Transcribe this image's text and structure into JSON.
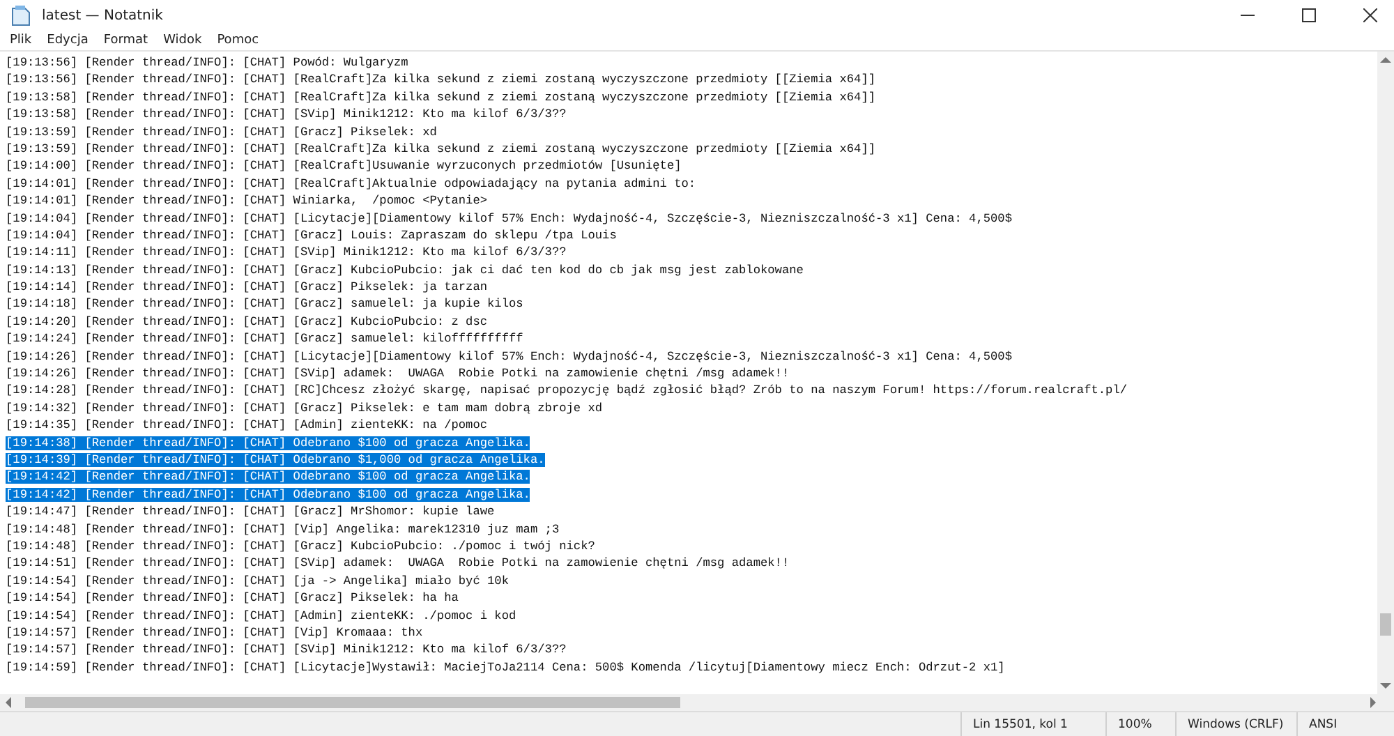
{
  "window": {
    "title": "latest — Notatnik"
  },
  "menu": [
    "Plik",
    "Edycja",
    "Format",
    "Widok",
    "Pomoc"
  ],
  "lines": [
    {
      "text": "[19:13:56] [Render thread/INFO]: [CHAT] Powód: Wulgaryzm",
      "selected": false
    },
    {
      "text": "[19:13:56] [Render thread/INFO]: [CHAT] [RealCraft]Za kilka sekund z ziemi zostaną wyczyszczone przedmioty [[Ziemia x64]]",
      "selected": false
    },
    {
      "text": "[19:13:58] [Render thread/INFO]: [CHAT] [RealCraft]Za kilka sekund z ziemi zostaną wyczyszczone przedmioty [[Ziemia x64]]",
      "selected": false
    },
    {
      "text": "[19:13:58] [Render thread/INFO]: [CHAT] [SVip] Minik1212: Kto ma kilof 6/3/3??",
      "selected": false
    },
    {
      "text": "[19:13:59] [Render thread/INFO]: [CHAT] [Gracz] Pikselek: xd",
      "selected": false
    },
    {
      "text": "[19:13:59] [Render thread/INFO]: [CHAT] [RealCraft]Za kilka sekund z ziemi zostaną wyczyszczone przedmioty [[Ziemia x64]]",
      "selected": false
    },
    {
      "text": "[19:14:00] [Render thread/INFO]: [CHAT] [RealCraft]Usuwanie wyrzuconych przedmiotów [Usunięte]",
      "selected": false
    },
    {
      "text": "[19:14:01] [Render thread/INFO]: [CHAT] [RealCraft]Aktualnie odpowiadający na pytania admini to:",
      "selected": false
    },
    {
      "text": "[19:14:01] [Render thread/INFO]: [CHAT] Winiarka,  /pomoc <Pytanie>",
      "selected": false
    },
    {
      "text": "[19:14:04] [Render thread/INFO]: [CHAT] [Licytacje][Diamentowy kilof 57% Ench: Wydajność-4, Szczęście-3, Niezniszczalność-3 x1] Cena: 4,500$",
      "selected": false
    },
    {
      "text": "[19:14:04] [Render thread/INFO]: [CHAT] [Gracz] Louis: Zapraszam do sklepu /tpa Louis",
      "selected": false
    },
    {
      "text": "[19:14:11] [Render thread/INFO]: [CHAT] [SVip] Minik1212: Kto ma kilof 6/3/3??",
      "selected": false
    },
    {
      "text": "[19:14:13] [Render thread/INFO]: [CHAT] [Gracz] KubcioPubcio: jak ci dać ten kod do cb jak msg jest zablokowane",
      "selected": false
    },
    {
      "text": "[19:14:14] [Render thread/INFO]: [CHAT] [Gracz] Pikselek: ja tarzan",
      "selected": false
    },
    {
      "text": "[19:14:18] [Render thread/INFO]: [CHAT] [Gracz] samuelel: ja kupie kilos",
      "selected": false
    },
    {
      "text": "[19:14:20] [Render thread/INFO]: [CHAT] [Gracz] KubcioPubcio: z dsc",
      "selected": false
    },
    {
      "text": "[19:14:24] [Render thread/INFO]: [CHAT] [Gracz] samuelel: kiloffffffffff",
      "selected": false
    },
    {
      "text": "[19:14:26] [Render thread/INFO]: [CHAT] [Licytacje][Diamentowy kilof 57% Ench: Wydajność-4, Szczęście-3, Niezniszczalność-3 x1] Cena: 4,500$",
      "selected": false
    },
    {
      "text": "[19:14:26] [Render thread/INFO]: [CHAT] [SVip] adamek:  UWAGA  Robie Potki na zamowienie chętni /msg adamek!!",
      "selected": false
    },
    {
      "text": "[19:14:28] [Render thread/INFO]: [CHAT] [RC]Chcesz złożyć skargę, napisać propozycję bądź zgłosić błąd? Zrób to na naszym Forum! https://forum.realcraft.pl/",
      "selected": false
    },
    {
      "text": "[19:14:32] [Render thread/INFO]: [CHAT] [Gracz] Pikselek: e tam mam dobrą zbroje xd",
      "selected": false
    },
    {
      "text": "[19:14:35] [Render thread/INFO]: [CHAT] [Admin] zienteKK: na /pomoc",
      "selected": false
    },
    {
      "text": "[19:14:38] [Render thread/INFO]: [CHAT] Odebrano $100 od gracza Angelika.",
      "selected": true
    },
    {
      "text": "[19:14:39] [Render thread/INFO]: [CHAT] Odebrano $1,000 od gracza Angelika.",
      "selected": true
    },
    {
      "text": "[19:14:42] [Render thread/INFO]: [CHAT] Odebrano $100 od gracza Angelika.",
      "selected": true
    },
    {
      "text": "[19:14:42] [Render thread/INFO]: [CHAT] Odebrano $100 od gracza Angelika.",
      "selected": true
    },
    {
      "text": "[19:14:47] [Render thread/INFO]: [CHAT] [Gracz] MrShomor: kupie lawe",
      "selected": false
    },
    {
      "text": "[19:14:48] [Render thread/INFO]: [CHAT] [Vip] Angelika: marek12310 juz mam ;3",
      "selected": false
    },
    {
      "text": "[19:14:48] [Render thread/INFO]: [CHAT] [Gracz] KubcioPubcio: ./pomoc i twój nick?",
      "selected": false
    },
    {
      "text": "[19:14:51] [Render thread/INFO]: [CHAT] [SVip] adamek:  UWAGA  Robie Potki na zamowienie chętni /msg adamek!!",
      "selected": false
    },
    {
      "text": "[19:14:54] [Render thread/INFO]: [CHAT] [ja -> Angelika] miało być 10k",
      "selected": false
    },
    {
      "text": "[19:14:54] [Render thread/INFO]: [CHAT] [Gracz] Pikselek: ha ha",
      "selected": false
    },
    {
      "text": "[19:14:54] [Render thread/INFO]: [CHAT] [Admin] zienteKK: ./pomoc i kod",
      "selected": false
    },
    {
      "text": "[19:14:57] [Render thread/INFO]: [CHAT] [Vip] Kromaaa: thx",
      "selected": false
    },
    {
      "text": "[19:14:57] [Render thread/INFO]: [CHAT] [SVip] Minik1212: Kto ma kilof 6/3/3??",
      "selected": false
    },
    {
      "text": "[19:14:59] [Render thread/INFO]: [CHAT] [Licytacje]Wystawił: MaciejToJa2114 Cena: 500$ Komenda /licytuj[Diamentowy miecz Ench: Odrzut-2 x1]",
      "selected": false
    }
  ],
  "status_bar": {
    "position": "Lin 15501, kol 1",
    "zoom": "100%",
    "line_endings": "Windows (CRLF)",
    "encoding": "ANSI"
  }
}
